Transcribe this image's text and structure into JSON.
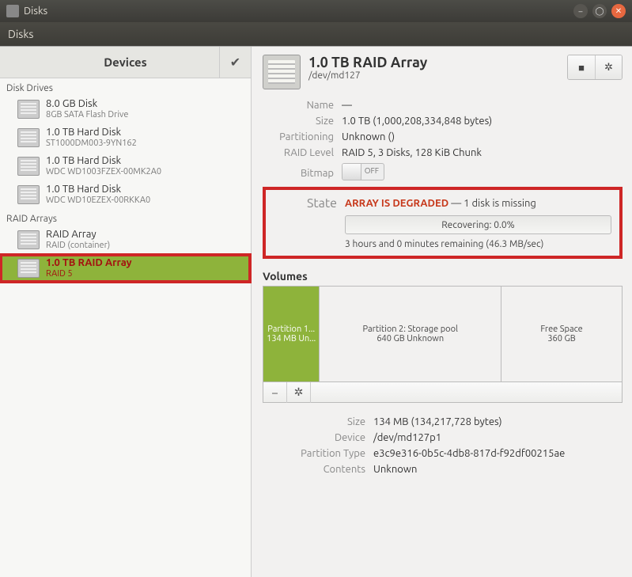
{
  "window": {
    "title": "Disks"
  },
  "toolbar": {
    "title": "Disks"
  },
  "sidebar": {
    "header": "Devices",
    "sections": [
      {
        "label": "Disk Drives",
        "items": [
          {
            "title": "8.0 GB Disk",
            "sub": "8GB SATA Flash Drive"
          },
          {
            "title": "1.0 TB Hard Disk",
            "sub": "ST1000DM003-9YN162"
          },
          {
            "title": "1.0 TB Hard Disk",
            "sub": "WDC WD1003FZEX-00MK2A0"
          },
          {
            "title": "1.0 TB Hard Disk",
            "sub": "WDC WD10EZEX-00RKKA0"
          }
        ]
      },
      {
        "label": "RAID Arrays",
        "items": [
          {
            "title": "RAID Array",
            "sub": "RAID (container)"
          },
          {
            "title": "1.0 TB RAID Array",
            "sub": "RAID 5",
            "selected": true
          }
        ]
      }
    ]
  },
  "main": {
    "title": "1.0 TB RAID Array",
    "path": "/dev/md127",
    "props": {
      "name_label": "Name",
      "name_value": "—",
      "size_label": "Size",
      "size_value": "1.0 TB (1,000,208,334,848 bytes)",
      "part_label": "Partitioning",
      "part_value": "Unknown ()",
      "raid_label": "RAID Level",
      "raid_value": "RAID 5, 3 Disks, 128 KiB Chunk",
      "bitmap_label": "Bitmap",
      "bitmap_switch": "OFF"
    },
    "state": {
      "label": "State",
      "degraded": "ARRAY IS DEGRADED",
      "rest": " — 1 disk is missing",
      "progress": "Recovering: 0.0%",
      "remaining": "3 hours and 0 minutes remaining (46.3 MB/sec)"
    },
    "volumes": {
      "title": "Volumes",
      "segs": [
        {
          "title": "Partition 1...",
          "sub": "134 MB Un...",
          "selected": true,
          "flex": 65
        },
        {
          "title": "Partition 2: Storage pool",
          "sub": "640 GB Unknown",
          "flex": 230
        },
        {
          "title": "Free Space",
          "sub": "360 GB",
          "flex": 150
        }
      ]
    },
    "details": {
      "size_label": "Size",
      "size_value": "134 MB (134,217,728 bytes)",
      "device_label": "Device",
      "device_value": "/dev/md127p1",
      "ptype_label": "Partition Type",
      "ptype_value": "e3c9e316-0b5c-4db8-817d-f92df00215ae",
      "contents_label": "Contents",
      "contents_value": "Unknown"
    }
  }
}
